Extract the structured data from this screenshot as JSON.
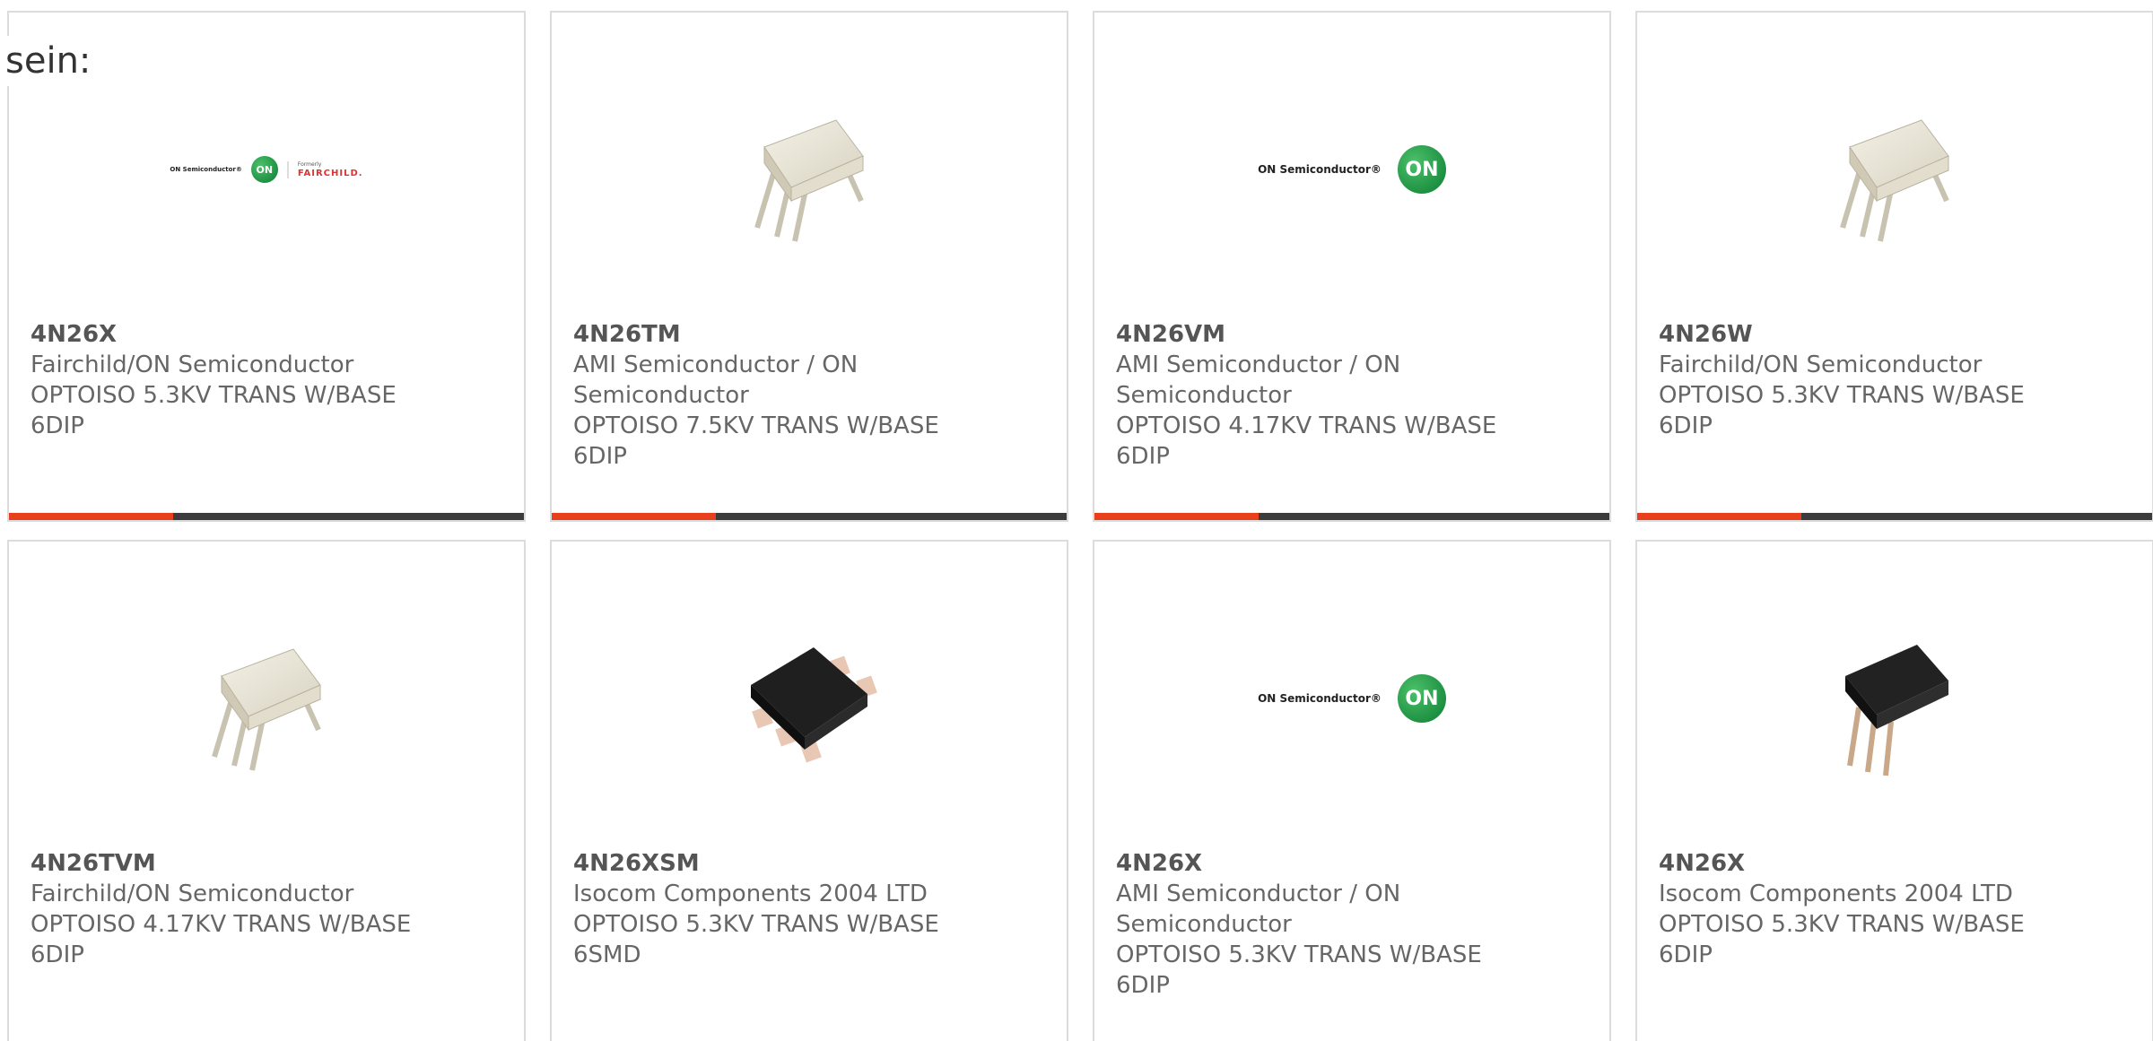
{
  "intro": "sein:",
  "colors": {
    "accent_bar": "#e8401c",
    "dark_bar": "#3c3c3c",
    "card_border": "#dcdcdc",
    "title_text": "#555555",
    "body_text": "#666666",
    "on_green": "#14913f",
    "fairchild_red": "#d33333"
  },
  "logos": {
    "on_semiconductor_text": "ON Semiconductor®",
    "on_badge": "ON",
    "fairchild_formerly": "Formerly",
    "fairchild_name": "FAIRCHILD."
  },
  "products": [
    {
      "part": "4N26X",
      "manufacturer": "Fairchild/ON Semiconductor",
      "description": "OPTOISO 5.3KV TRANS W/BASE 6DIP",
      "image": "on-fairchild-logo"
    },
    {
      "part": "4N26TM",
      "manufacturer": "AMI Semiconductor / ON Semiconductor",
      "description": "OPTOISO 7.5KV TRANS W/BASE 6DIP",
      "image": "white-6dip-chip"
    },
    {
      "part": "4N26VM",
      "manufacturer": "AMI Semiconductor / ON Semiconductor",
      "description": "OPTOISO 4.17KV TRANS W/BASE 6DIP",
      "image": "on-semiconductor-logo"
    },
    {
      "part": "4N26W",
      "manufacturer": "Fairchild/ON Semiconductor",
      "description": "OPTOISO 5.3KV TRANS W/BASE 6DIP",
      "image": "white-6dip-chip"
    },
    {
      "part": "4N26TVM",
      "manufacturer": "Fairchild/ON Semiconductor",
      "description": "OPTOISO 4.17KV TRANS W/BASE 6DIP",
      "image": "white-6dip-chip"
    },
    {
      "part": "4N26XSM",
      "manufacturer": "Isocom Components 2004 LTD",
      "description": "OPTOISO 5.3KV TRANS W/BASE 6SMD",
      "image": "black-6smd-chip"
    },
    {
      "part": "4N26X",
      "manufacturer": "AMI Semiconductor / ON Semiconductor",
      "description": "OPTOISO 5.3KV TRANS W/BASE 6DIP",
      "image": "on-semiconductor-logo"
    },
    {
      "part": "4N26X",
      "manufacturer": "Isocom Components 2004 LTD",
      "description": "OPTOISO 5.3KV TRANS W/BASE 6DIP",
      "image": "black-6dip-chip"
    }
  ]
}
